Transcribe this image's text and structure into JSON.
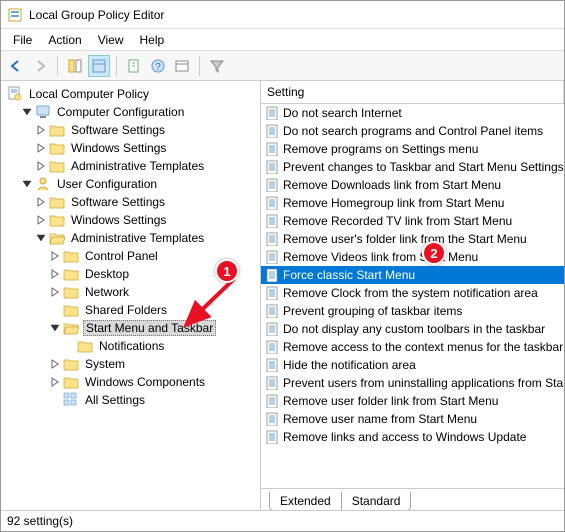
{
  "window": {
    "title": "Local Group Policy Editor"
  },
  "menu": {
    "file": "File",
    "action": "Action",
    "view": "View",
    "help": "Help"
  },
  "tree": {
    "root": "Local Computer Policy",
    "cc": "Computer Configuration",
    "cc_sw": "Software Settings",
    "cc_win": "Windows Settings",
    "cc_at": "Administrative Templates",
    "uc": "User Configuration",
    "uc_sw": "Software Settings",
    "uc_win": "Windows Settings",
    "uc_at": "Administrative Templates",
    "cp": "Control Panel",
    "desktop": "Desktop",
    "network": "Network",
    "shared": "Shared Folders",
    "smtb": "Start Menu and Taskbar",
    "notif": "Notifications",
    "system": "System",
    "wincomp": "Windows Components",
    "all": "All Settings"
  },
  "list": {
    "header": "Setting",
    "items": [
      "Do not search Internet",
      "Do not search programs and Control Panel items",
      "Remove programs on Settings menu",
      "Prevent changes to Taskbar and Start Menu Settings",
      "Remove Downloads link from Start Menu",
      "Remove Homegroup link from Start Menu",
      "Remove Recorded TV link from Start Menu",
      "Remove user's folder link from the Start Menu",
      "Remove Videos link from Start Menu",
      "Force classic Start Menu",
      "Remove Clock from the system notification area",
      "Prevent grouping of taskbar items",
      "Do not display any custom toolbars in the taskbar",
      "Remove access to the context menus for the taskbar",
      "Hide the notification area",
      "Prevent users from uninstalling applications from Start",
      "Remove user folder link from Start Menu",
      "Remove user name from Start Menu",
      "Remove links and access to Windows Update"
    ],
    "selected_index": 9
  },
  "tabs": {
    "extended": "Extended",
    "standard": "Standard"
  },
  "status": {
    "text": "92 setting(s)"
  },
  "annotations": {
    "badge1": "1",
    "badge2": "2"
  }
}
